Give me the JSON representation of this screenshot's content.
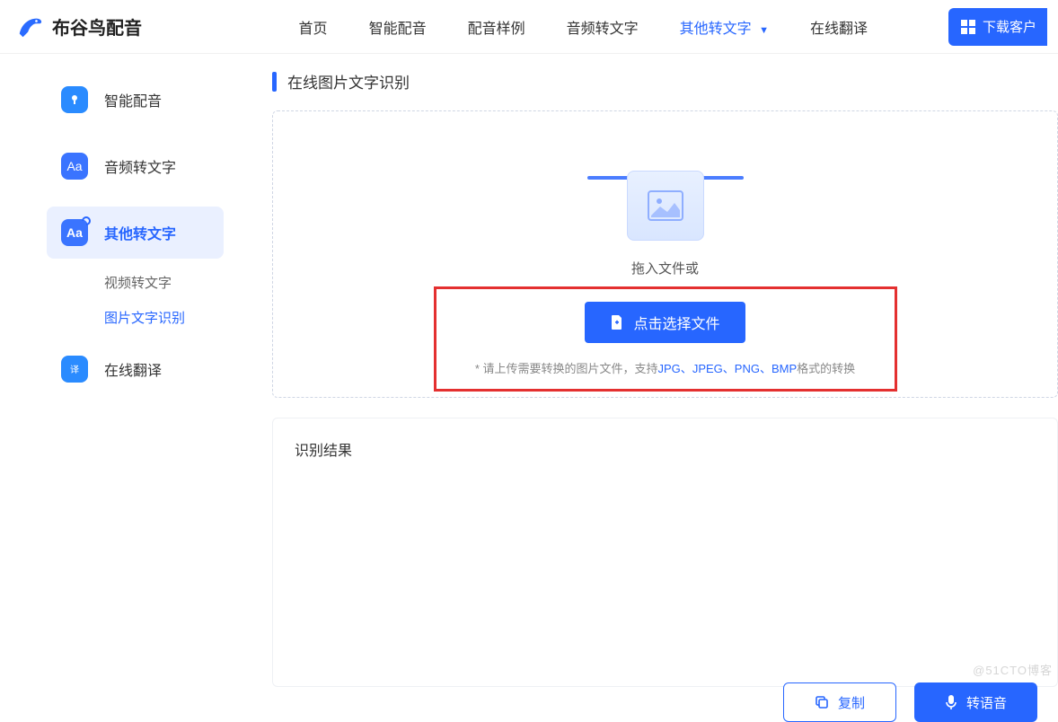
{
  "brand": "布谷鸟配音",
  "nav": {
    "home": "首页",
    "tts": "智能配音",
    "samples": "配音样例",
    "audio2text": "音频转文字",
    "other2text": "其他转文字",
    "translate": "在线翻译",
    "download": "下载客户"
  },
  "sidebar": {
    "tts": "智能配音",
    "audio2text": "音频转文字",
    "other2text": "其他转文字",
    "sub_video": "视频转文字",
    "sub_image": "图片文字识别",
    "translate": "在线翻译"
  },
  "page": {
    "title": "在线图片文字识别",
    "drag_hint": "拖入文件或",
    "choose_btn": "点击选择文件",
    "format_hint_prefix": "* 请上传需要转换的图片文件，支持",
    "fmt_jpg": "JPG",
    "fmt_jpeg": "JPEG",
    "fmt_png": "PNG",
    "fmt_bmp": "BMP",
    "format_hint_suffix": "格式的转换",
    "sep": "、"
  },
  "result": {
    "title": "识别结果",
    "copy": "复制",
    "to_speech": "转语音"
  },
  "watermark": "@51CTO博客"
}
